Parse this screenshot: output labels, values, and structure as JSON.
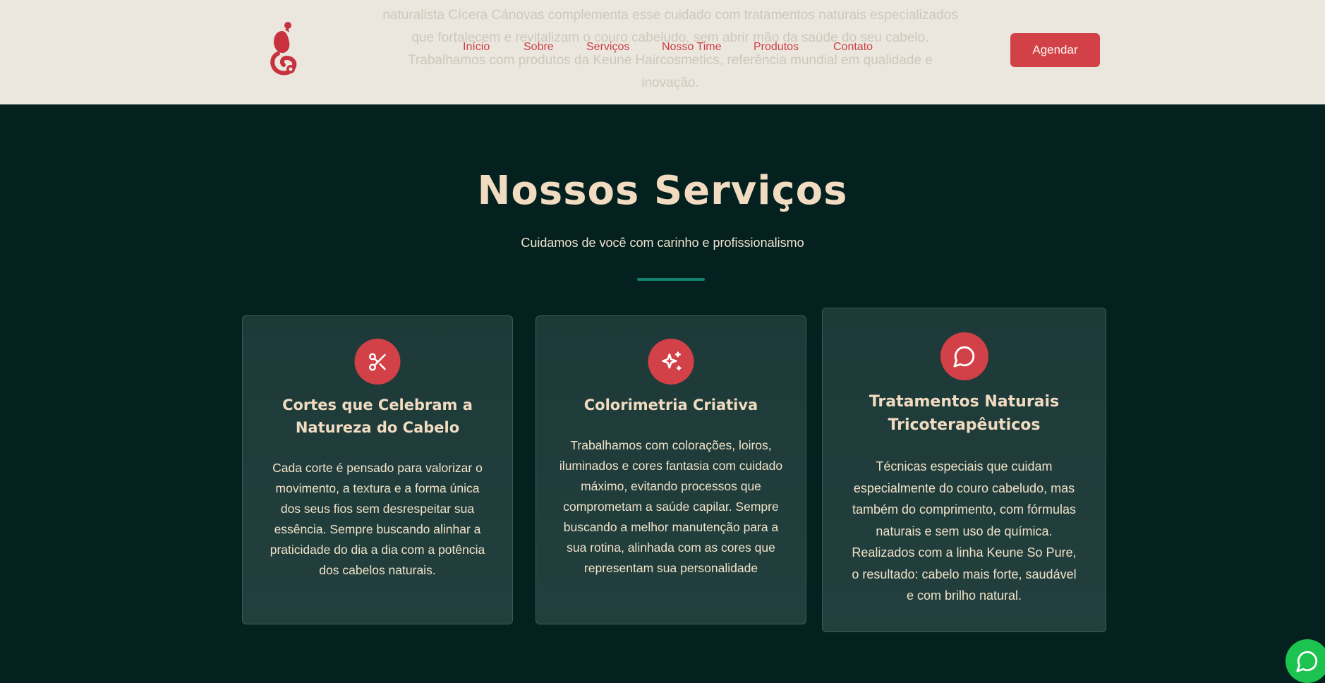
{
  "header": {
    "ghost_lines": [
      "naturalista Cícera Cánovas complementa esse cuidado com tratamentos naturais especializados",
      "que fortalecem e revitalizam o couro cabeludo, sem abrir mão da saúde do seu cabelo.",
      "Trabalhamos com produtos da Keune Haircosmetics, referência mundial em qualidade e",
      "inovação."
    ],
    "logo_icon": "g-logo-icon",
    "nav": [
      {
        "label": "Início"
      },
      {
        "label": "Sobre"
      },
      {
        "label": "Serviços"
      },
      {
        "label": "Nosso Time"
      },
      {
        "label": "Produtos"
      },
      {
        "label": "Contato"
      }
    ],
    "cta_label": "Agendar"
  },
  "section": {
    "title": "Nossos Serviços",
    "subtitle": "Cuidamos de você com carinho e profissionalismo",
    "cards": [
      {
        "icon": "scissors-icon",
        "title": "Cortes que Celebram a Natureza do Cabelo",
        "description": "Cada corte é pensado para valorizar o movimento, a textura e a forma única dos seus fios sem desrespeitar sua essência. Sempre buscando alinhar a praticidade do dia a dia com a potência dos cabelos naturais."
      },
      {
        "icon": "sparkles-icon",
        "title": "Colorimetria Criativa",
        "description": "Trabalhamos com colorações, loiros, iluminados e cores fantasia com cuidado máximo, evitando processos que comprometam a saúde capilar. Sempre buscando a melhor manutenção para a sua rotina, alinhada com as cores que representam sua personalidade"
      },
      {
        "icon": "chat-bubble-icon",
        "title": "Tratamentos Naturais Tricoterapêuticos",
        "description": "Técnicas especiais que cuidam especialmente do couro cabeludo, mas também do comprimento, com fórmulas naturais e sem uso de química. Realizados com a linha Keune So Pure, o resultado: cabelo mais forte, saudável e com brilho natural."
      }
    ]
  },
  "whatsapp_icon": "whatsapp-icon",
  "colors": {
    "background": "#04211f",
    "header_bg": "#ebe7df",
    "accent": "#d24147",
    "title": "#f2dcc1",
    "divider": "#13806f",
    "whatsapp": "#1dc34f"
  }
}
